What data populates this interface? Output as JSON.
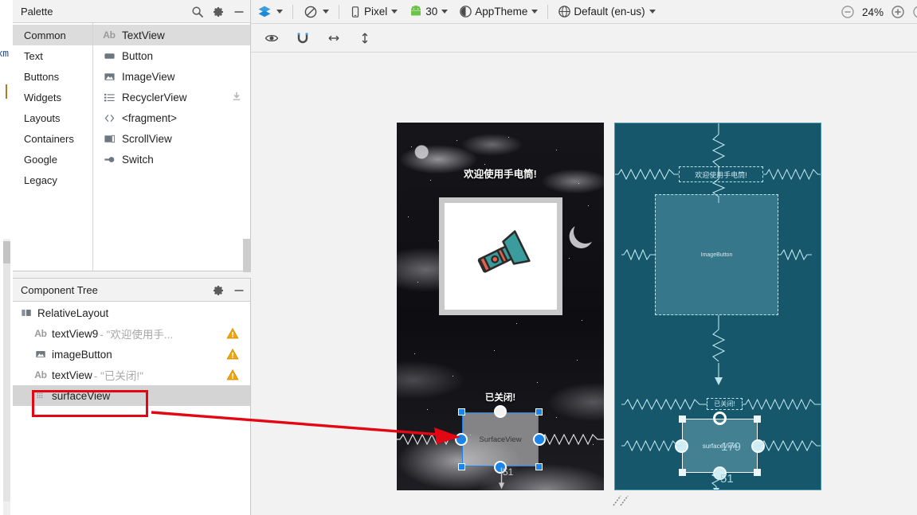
{
  "editor_strip": {
    "tab_text_fragment": "xm"
  },
  "palette": {
    "title": "Palette",
    "header_icons": [
      "search-icon",
      "gear-icon",
      "minimize-icon"
    ],
    "categories": [
      {
        "label": "Common",
        "selected": true
      },
      {
        "label": "Text",
        "selected": false
      },
      {
        "label": "Buttons",
        "selected": false
      },
      {
        "label": "Widgets",
        "selected": false
      },
      {
        "label": "Layouts",
        "selected": false
      },
      {
        "label": "Containers",
        "selected": false
      },
      {
        "label": "Google",
        "selected": false
      },
      {
        "label": "Legacy",
        "selected": false
      }
    ],
    "items": [
      {
        "label": "TextView",
        "icon": "textview-ab-icon",
        "selected": true,
        "download": false
      },
      {
        "label": "Button",
        "icon": "button-icon",
        "selected": false,
        "download": false
      },
      {
        "label": "ImageView",
        "icon": "imageview-icon",
        "selected": false,
        "download": false
      },
      {
        "label": "RecyclerView",
        "icon": "recyclerview-list-icon",
        "selected": false,
        "download": true
      },
      {
        "label": "<fragment>",
        "icon": "fragment-angle-brackets-icon",
        "selected": false,
        "download": false
      },
      {
        "label": "ScrollView",
        "icon": "scrollview-icon",
        "selected": false,
        "download": false
      },
      {
        "label": "Switch",
        "icon": "switch-icon",
        "selected": false,
        "download": false
      }
    ]
  },
  "component_tree": {
    "title": "Component Tree",
    "header_icons": [
      "gear-icon",
      "minimize-icon"
    ],
    "rows": [
      {
        "icon": "relativelayout-icon",
        "id": "RelativeLayout",
        "sub": "",
        "warning": false,
        "selected": false,
        "indent": 0
      },
      {
        "icon": "textview-ab-icon",
        "id": "textView9",
        "sub": "- \"欢迎使用手...",
        "warning": true,
        "selected": false,
        "indent": 1
      },
      {
        "icon": "imageview-icon",
        "id": "imageButton",
        "sub": "",
        "warning": true,
        "selected": false,
        "indent": 1
      },
      {
        "icon": "textview-ab-icon",
        "id": "textView",
        "sub": "- \"已关闭!\"",
        "warning": true,
        "selected": false,
        "indent": 1
      },
      {
        "icon": "surfaceview-icon",
        "id": "surfaceView",
        "sub": "",
        "warning": false,
        "selected": true,
        "indent": 1
      }
    ]
  },
  "toolbar": {
    "design_mode": {
      "label": "",
      "icon": "layers-design-icon"
    },
    "orientation": {
      "label": "",
      "icon": "rotate-orientation-icon"
    },
    "device": {
      "label": "Pixel",
      "icon": "phone-device-icon"
    },
    "api": {
      "label": "30",
      "icon": "android-robot-icon"
    },
    "theme": {
      "label": "AppTheme",
      "icon": "theme-contrast-icon"
    },
    "locale": {
      "label": "Default (en-us)",
      "icon": "globe-locale-icon"
    },
    "zoom_out_icon": "zoom-out-icon",
    "zoom_level": "24%",
    "zoom_in_icon": "zoom-in-icon",
    "zoom_fit_icon": "zoom-fit-icon"
  },
  "toolbar2": {
    "buttons": [
      {
        "icon": "eye-visibility-icon",
        "name": "show-constraints-toggle"
      },
      {
        "icon": "magnet-autoconnect-icon",
        "name": "autoconnect-toggle"
      },
      {
        "icon": "horizontal-align-icon",
        "name": "horizontal-guideline-button"
      },
      {
        "icon": "vertical-align-icon",
        "name": "vertical-guideline-button"
      }
    ]
  },
  "preview": {
    "title_text": "欢迎使用手电筒!",
    "status_text": "已关闭!",
    "surface_label": "SurfaceView",
    "bottom_constraint": "51"
  },
  "blueprint": {
    "title_text": "欢迎使用手电筒!",
    "image_button_label": "ImageButton",
    "status_text": "已关闭!",
    "surface_label": "surfaceView",
    "right_constraint": "179",
    "bottom_constraint": "51"
  },
  "colors": {
    "accent_blue": "#1a84e8",
    "blueprint_bg": "#16576b",
    "blueprint_line": "#bfe6ef",
    "warning_orange": "#f0a30a",
    "annotation_red": "#e30613",
    "selection_gray": "#d4d4d4"
  }
}
